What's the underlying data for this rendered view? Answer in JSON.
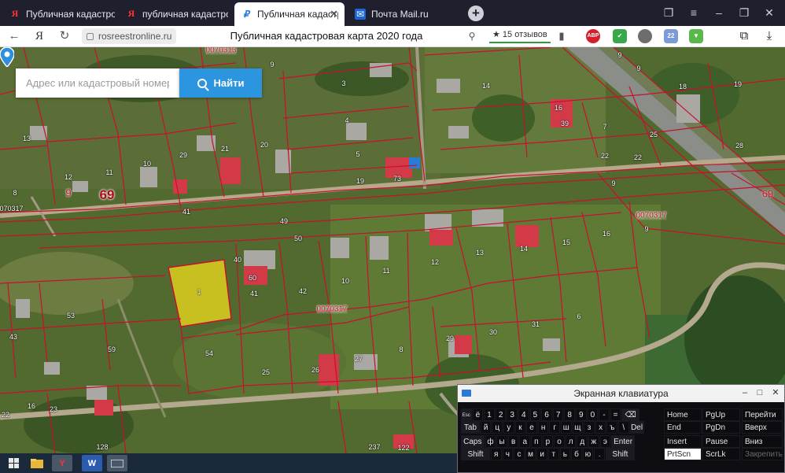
{
  "browser": {
    "tabs": [
      {
        "label": "Публичная кадастровая к",
        "icon": "yandex-icon",
        "active": false
      },
      {
        "label": "публичная кадастровая к",
        "icon": "yandex-icon",
        "active": false
      },
      {
        "label": "Публичная кадастровая к",
        "icon": "rosreestr-icon",
        "active": true
      },
      {
        "label": "Почта Mail.ru",
        "icon": "mail-icon",
        "active": false
      }
    ],
    "address": {
      "domain": "rosreestronline.ru",
      "page_title": "Публичная кадастровая карта 2020 года",
      "reviews": "★ 15 отзывов"
    },
    "extensions": [
      {
        "name": "adblock-plus-icon",
        "label": "ABP",
        "color": "#d51e2a"
      },
      {
        "name": "shield-check-icon",
        "label": "✔",
        "color": "#3aa84a"
      },
      {
        "name": "bulb-icon",
        "label": "",
        "color": "#6d6d6d"
      },
      {
        "name": "weather-icon",
        "label": "22",
        "color": "#7d9ad8"
      },
      {
        "name": "download-arrow-icon",
        "label": "",
        "color": "#59b84a"
      }
    ]
  },
  "map": {
    "search": {
      "placeholder": "Адрес или кадастровый номер",
      "button_label": "Найти"
    },
    "quarter_labels": [
      "0070313",
      "0070317",
      "0070317"
    ],
    "zone_label": "69",
    "plot_numbers": [
      "9",
      "9",
      "9",
      "3",
      "14",
      "18",
      "19",
      "13",
      "21",
      "20",
      "4",
      "16",
      "39",
      "7",
      "25",
      "28",
      "12",
      "11",
      "10",
      "29",
      "5",
      "73",
      "19",
      "22",
      "22",
      "8",
      "9",
      "69",
      "41",
      "49",
      "9",
      "9",
      "0070317",
      "16",
      "50",
      "40",
      "60",
      "12",
      "13",
      "14",
      "15",
      "11",
      "10",
      "41",
      "42",
      "53",
      "6",
      "43",
      "59",
      "54",
      "31",
      "30",
      "29",
      "8",
      "25",
      "27",
      "26",
      "23",
      "22",
      "16",
      "237",
      "122",
      "128",
      "1"
    ],
    "accent_color": "#c8102e",
    "selected_plot_color": "#f4e21a"
  },
  "keyboard": {
    "title": "Экранная клавиатура",
    "rows": [
      [
        "Esc",
        "ё",
        "1",
        "2",
        "3",
        "4",
        "5",
        "6",
        "7",
        "8",
        "9",
        "0",
        "-",
        "=",
        "⌫"
      ],
      [
        "Tab",
        "й",
        "ц",
        "у",
        "к",
        "е",
        "н",
        "г",
        "ш",
        "щ",
        "з",
        "х",
        "ъ",
        "\\",
        "Del"
      ],
      [
        "Caps",
        "ф",
        "ы",
        "в",
        "а",
        "п",
        "р",
        "о",
        "л",
        "д",
        "ж",
        "э",
        "Enter"
      ],
      [
        "Shift",
        "я",
        "ч",
        "с",
        "м",
        "и",
        "т",
        "ь",
        "б",
        "ю",
        ".",
        "Shift"
      ]
    ],
    "nav_keys": [
      [
        "Home",
        "PgUp",
        "Перейти"
      ],
      [
        "End",
        "PgDn",
        "Вверх"
      ],
      [
        "Insert",
        "Pause",
        "Вниз"
      ],
      [
        "PrtScn",
        "ScrLk",
        "Закрепить"
      ]
    ]
  },
  "taskbar": {
    "items": [
      {
        "name": "start-icon",
        "label": ""
      },
      {
        "name": "file-explorer-icon",
        "label": ""
      },
      {
        "name": "yandex-browser-icon",
        "label": "Y"
      },
      {
        "name": "word-icon",
        "label": "W"
      },
      {
        "name": "on-screen-keyboard-icon",
        "label": ""
      }
    ]
  }
}
